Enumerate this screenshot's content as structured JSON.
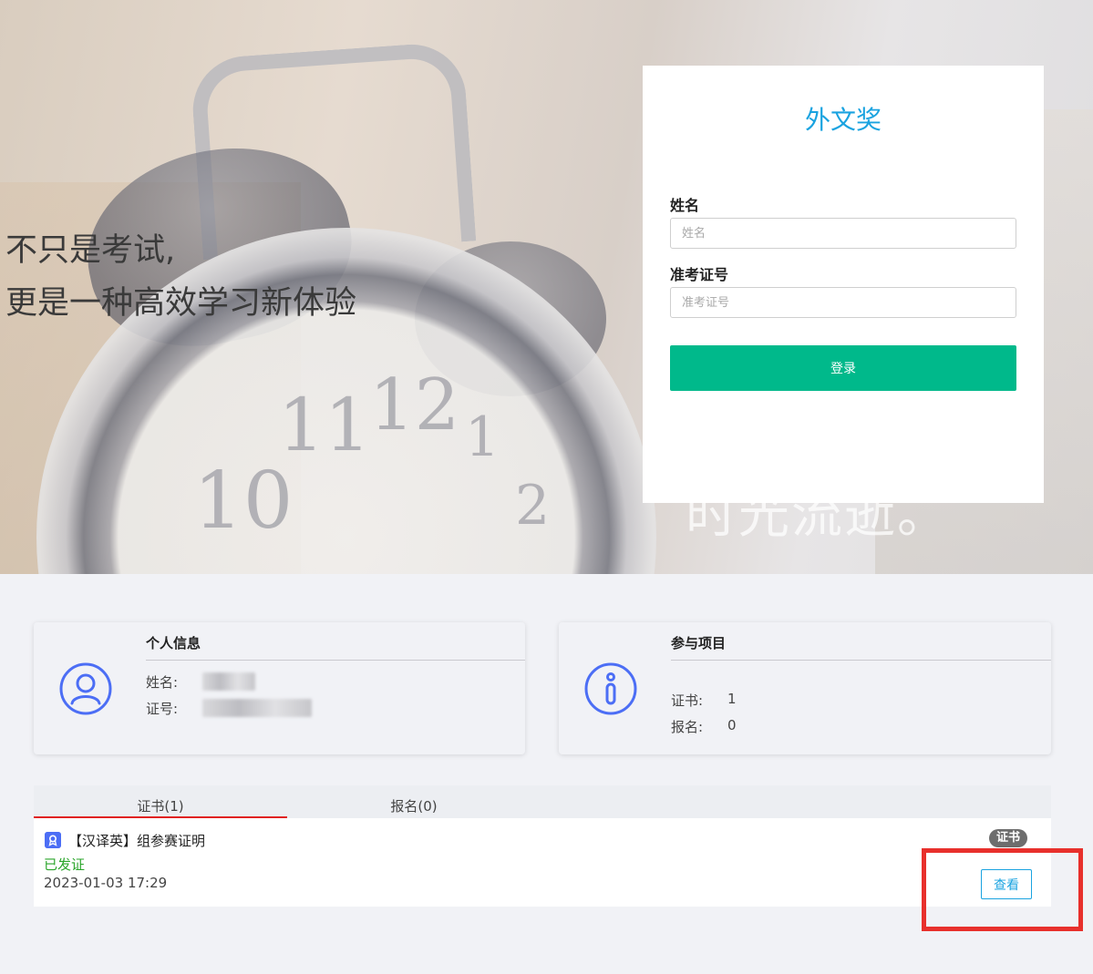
{
  "hero": {
    "slogan_line1": "不只是考试,",
    "slogan_line2": "更是一种高效学习新体验",
    "clock_numbers": [
      "11",
      "12",
      "1",
      "10",
      "2"
    ],
    "background_text": "时光流逝。"
  },
  "login": {
    "title": "外文奖",
    "name_label": "姓名",
    "name_placeholder": "姓名",
    "id_label": "准考证号",
    "id_placeholder": "准考证号",
    "submit_label": "登录"
  },
  "personal_info": {
    "title": "个人信息",
    "name_label": "姓名:",
    "id_label": "证号:",
    "icon": "user-icon"
  },
  "projects": {
    "title": "参与项目",
    "certificate_label": "证书:",
    "certificate_count": "1",
    "registration_label": "报名:",
    "registration_count": "0",
    "icon": "info-icon"
  },
  "tabs": [
    {
      "label": "证书(1)"
    },
    {
      "label": "报名(0)"
    }
  ],
  "certificates": [
    {
      "title": "【汉译英】组参赛证明",
      "status": "已发证",
      "date": "2023-01-03 17:29",
      "badge": "证书",
      "action_label": "查看"
    }
  ],
  "colors": {
    "accent_blue": "#1aa3e0",
    "login_button": "#00b98b",
    "status_green": "#2aa52a",
    "tab_underline": "#e02020",
    "highlight_red": "#e8302c",
    "icon_blue": "#4c6ef5"
  }
}
